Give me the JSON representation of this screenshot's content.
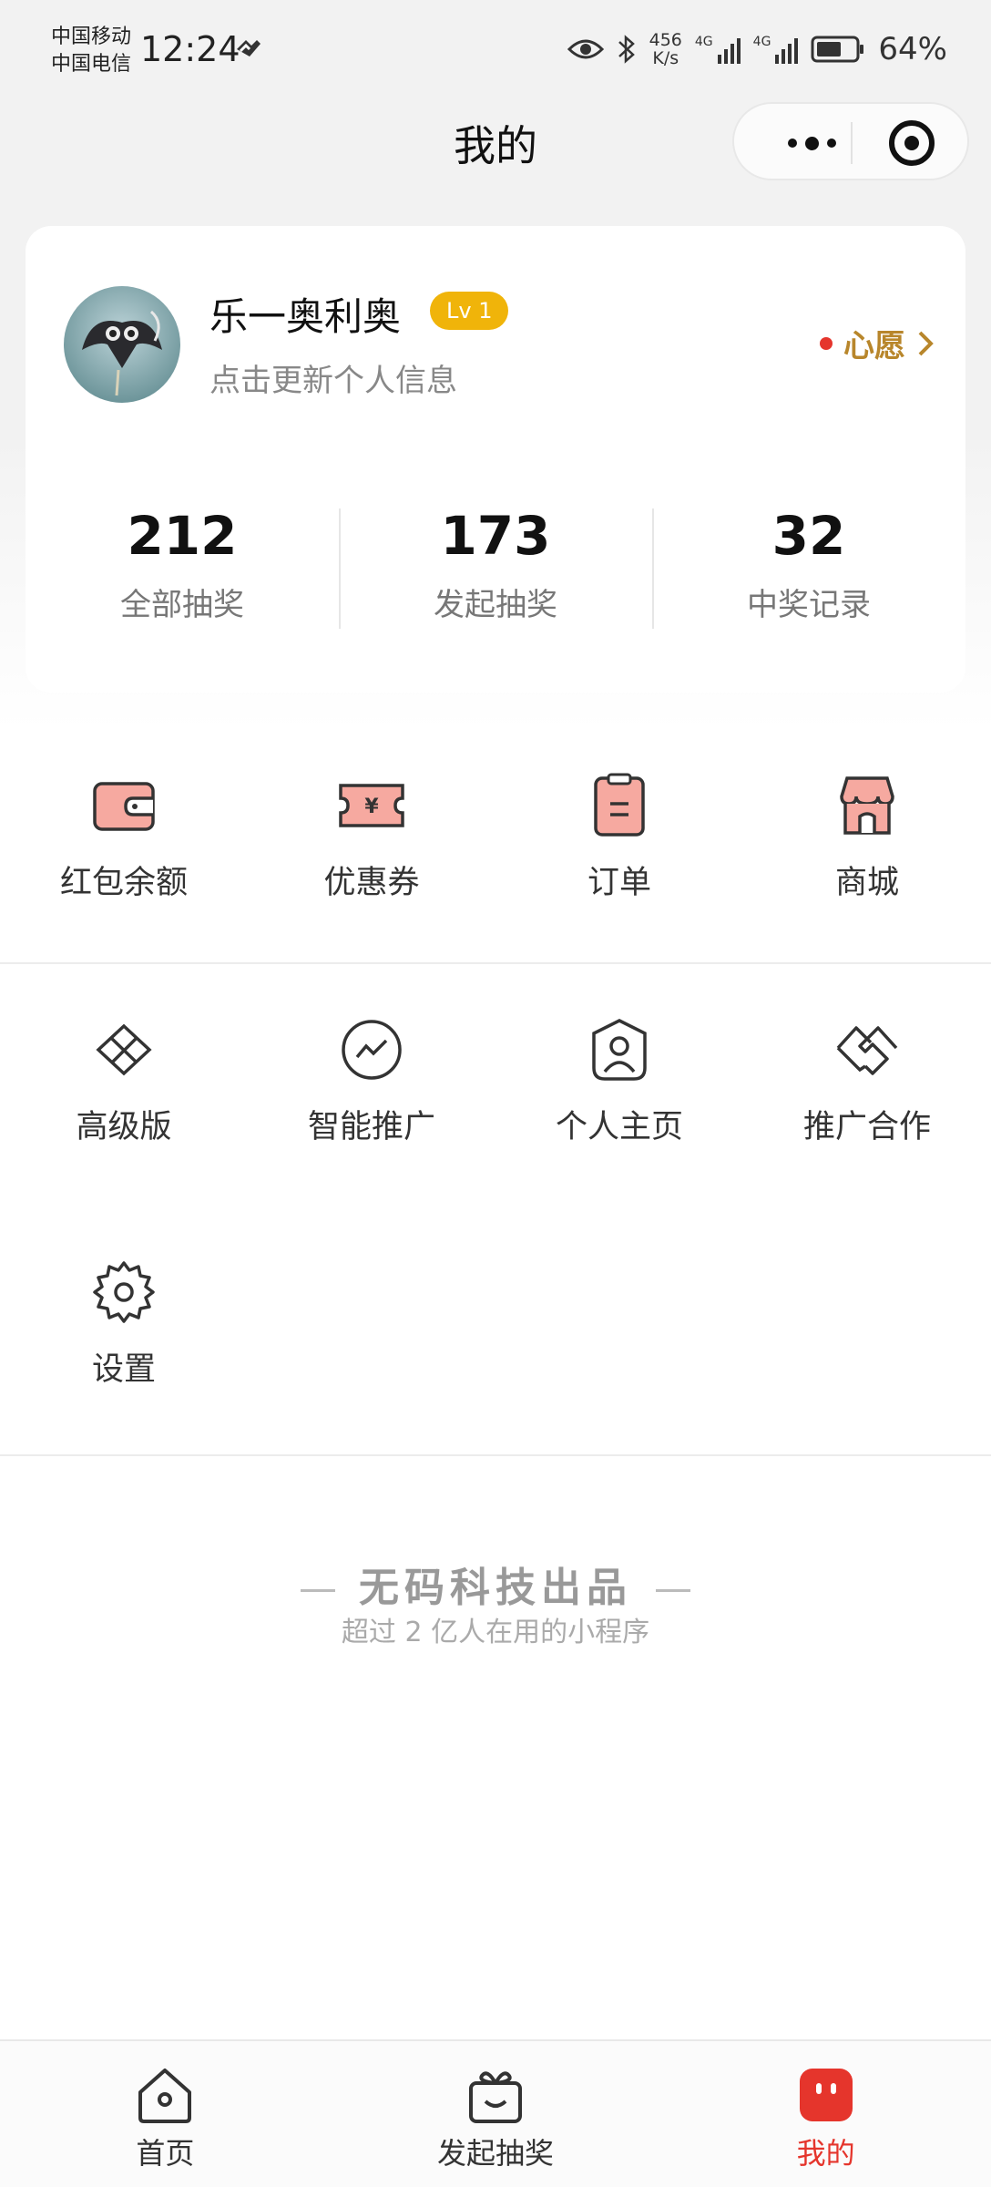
{
  "status_bar": {
    "carrier_1": "中国移动",
    "carrier_2": "中国电信",
    "time": "12:24",
    "net_speed_value": "456",
    "net_speed_unit": "K/s",
    "signal_1_label": "4G",
    "signal_2_label": "4G",
    "battery": "64%",
    "battery_level": 0.64
  },
  "header": {
    "title": "我的"
  },
  "profile": {
    "username": "乐一奥利奥",
    "level": "Lv 1",
    "subtitle": "点击更新个人信息",
    "wish_label": "心愿",
    "stats": [
      {
        "value": "212",
        "label": "全部抽奖"
      },
      {
        "value": "173",
        "label": "发起抽奖"
      },
      {
        "value": "32",
        "label": "中奖记录"
      }
    ]
  },
  "menu_row_1": [
    {
      "label": "红包余额",
      "icon": "wallet-icon"
    },
    {
      "label": "优惠券",
      "icon": "coupon-icon"
    },
    {
      "label": "订单",
      "icon": "order-icon"
    },
    {
      "label": "商城",
      "icon": "store-icon"
    }
  ],
  "menu_row_2": [
    {
      "label": "高级版",
      "icon": "diamond-icon"
    },
    {
      "label": "智能推广",
      "icon": "trend-icon"
    },
    {
      "label": "个人主页",
      "icon": "profile-icon"
    },
    {
      "label": "推广合作",
      "icon": "handshake-icon"
    }
  ],
  "menu_row_3": [
    {
      "label": "设置",
      "icon": "gear-icon"
    }
  ],
  "brand": {
    "name": "无码科技出品",
    "tagline": "超过 2 亿人在用的小程序"
  },
  "tab_bar": {
    "items": [
      {
        "label": "首页",
        "icon": "home-icon"
      },
      {
        "label": "发起抽奖",
        "icon": "gift-icon"
      },
      {
        "label": "我的",
        "icon": "mine-icon"
      }
    ],
    "active_index": 2
  },
  "colors": {
    "accent": "#e5352c",
    "icon_fill": "#f6a9a0",
    "level_badge": "#f0b40a",
    "wish_text": "#b8862b"
  }
}
